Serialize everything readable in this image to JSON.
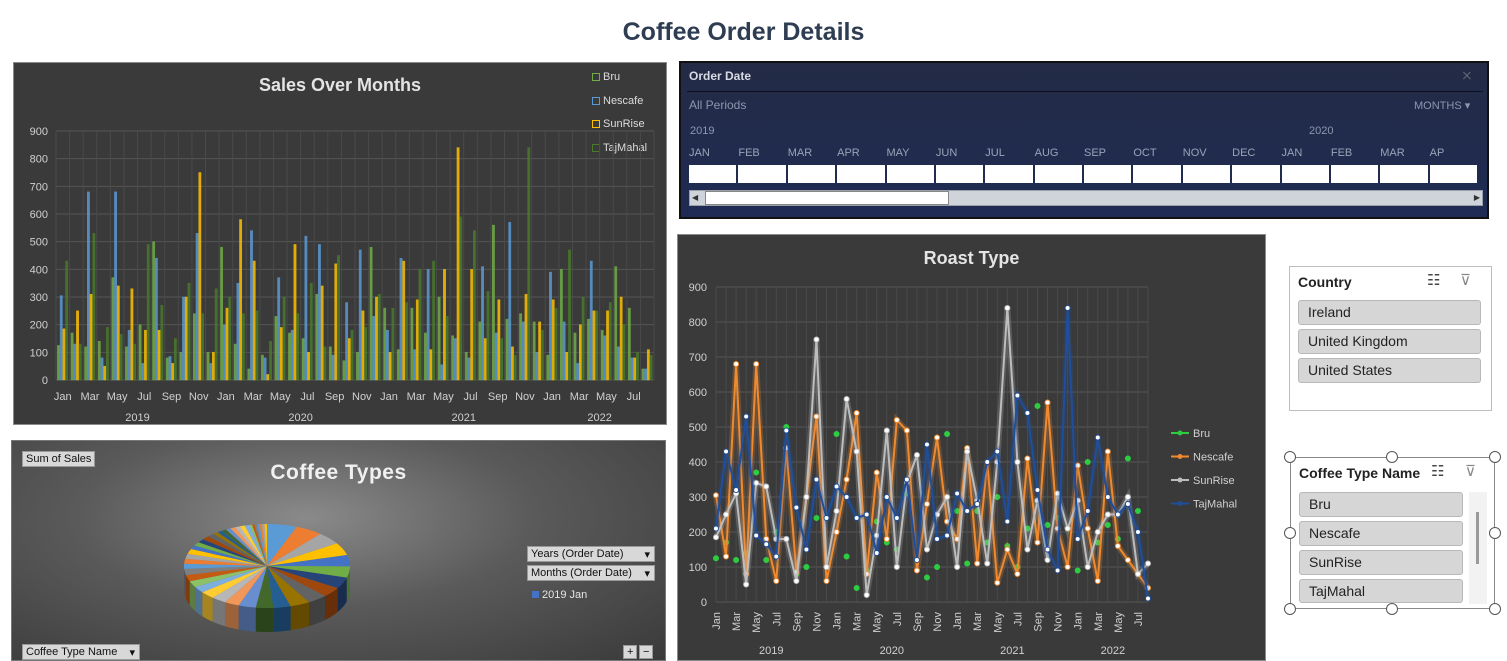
{
  "page": {
    "title": "Coffee Order Details"
  },
  "sales_chart": {
    "title": "Sales Over Months",
    "legend": [
      {
        "name": "Bru",
        "color": "#70ad47"
      },
      {
        "name": "Nescafe",
        "color": "#5b9bd5"
      },
      {
        "name": "SunRise",
        "color": "#ffc000"
      },
      {
        "name": "TajMahal",
        "color": "#4a7a2c"
      }
    ],
    "y_ticks": [
      "900",
      "800",
      "700",
      "600",
      "500",
      "400",
      "300",
      "200",
      "100",
      "0"
    ],
    "x_ticks": [
      "Jan",
      "Mar",
      "May",
      "Jul",
      "Sep",
      "Nov",
      "Jan",
      "Mar",
      "May",
      "Jul",
      "Sep",
      "Nov",
      "Jan",
      "Mar",
      "May",
      "Jul",
      "Sep",
      "Nov",
      "Jan",
      "Mar",
      "May",
      "Jul"
    ],
    "year_labels": [
      "2019",
      "2020",
      "2021",
      "2022"
    ]
  },
  "timeline": {
    "header": "Order Date",
    "periods": "All Periods",
    "unit": "MONTHS",
    "year_a": "2019",
    "year_b": "2020",
    "months": [
      "JAN",
      "FEB",
      "MAR",
      "APR",
      "MAY",
      "JUN",
      "JUL",
      "AUG",
      "SEP",
      "OCT",
      "NOV",
      "DEC",
      "JAN",
      "FEB",
      "MAR",
      "AP"
    ]
  },
  "pie_chart": {
    "title": "Coffee Types",
    "field_button": "Sum of Sales",
    "filter_years": "Years (Order Date)",
    "filter_months": "Months (Order Date)",
    "legend_entry": "2019 Jan",
    "axis_button": "Coffee Type Name"
  },
  "roast_chart": {
    "title": "Roast Type",
    "legend": [
      {
        "name": "Bru",
        "color": "#2ecc40"
      },
      {
        "name": "Nescafe",
        "color": "#f08a30"
      },
      {
        "name": "SunRise",
        "color": "#bdbdbd"
      },
      {
        "name": "TajMahal",
        "color": "#1f4e9a"
      }
    ],
    "y_ticks": [
      "900",
      "800",
      "700",
      "600",
      "500",
      "400",
      "300",
      "200",
      "100",
      "0"
    ],
    "x_ticks": [
      "Jan",
      "Mar",
      "May",
      "Jul",
      "Sep",
      "Nov",
      "Jan",
      "Mar",
      "May",
      "Jul",
      "Sep",
      "Nov",
      "Jan",
      "Mar",
      "May",
      "Jul",
      "Sep",
      "Nov",
      "Jan",
      "Mar",
      "May",
      "Jul"
    ],
    "year_labels": [
      "2019",
      "2020",
      "2021",
      "2022"
    ]
  },
  "country_slicer": {
    "title": "Country",
    "items": [
      "Ireland",
      "United Kingdom",
      "United States"
    ]
  },
  "coffee_slicer": {
    "title": "Coffee Type Name",
    "items": [
      "Bru",
      "Nescafe",
      "SunRise",
      "TajMahal"
    ]
  },
  "chart_data": [
    {
      "type": "bar",
      "title": "Sales Over Months",
      "ylim": [
        0,
        900
      ],
      "grid": true,
      "legend_position": "top-right",
      "x": [
        "2019-01",
        "2019-02",
        "2019-03",
        "2019-04",
        "2019-05",
        "2019-06",
        "2019-07",
        "2019-08",
        "2019-09",
        "2019-10",
        "2019-11",
        "2019-12",
        "2020-01",
        "2020-02",
        "2020-03",
        "2020-04",
        "2020-05",
        "2020-06",
        "2020-07",
        "2020-08",
        "2020-09",
        "2020-10",
        "2020-11",
        "2020-12",
        "2021-01",
        "2021-02",
        "2021-03",
        "2021-04",
        "2021-05",
        "2021-06",
        "2021-07",
        "2021-08",
        "2021-09",
        "2021-10",
        "2021-11",
        "2021-12",
        "2022-01",
        "2022-02",
        "2022-03",
        "2022-04",
        "2022-05",
        "2022-06",
        "2022-07",
        "2022-08"
      ],
      "series": [
        {
          "name": "Bru",
          "values": [
            125,
            170,
            120,
            140,
            370,
            120,
            200,
            500,
            80,
            100,
            240,
            100,
            480,
            130,
            40,
            90,
            230,
            170,
            150,
            310,
            120,
            70,
            100,
            480,
            260,
            110,
            260,
            170,
            300,
            160,
            100,
            210,
            560,
            220,
            240,
            210,
            90,
            400,
            170,
            220,
            180,
            410,
            260,
            40
          ]
        },
        {
          "name": "Nescafe",
          "values": [
            305,
            130,
            680,
            80,
            680,
            180,
            60,
            440,
            85,
            300,
            530,
            60,
            200,
            350,
            540,
            80,
            370,
            180,
            520,
            490,
            90,
            280,
            470,
            230,
            180,
            440,
            110,
            400,
            55,
            150,
            80,
            410,
            170,
            570,
            210,
            100,
            390,
            210,
            60,
            430,
            160,
            120,
            80,
            40
          ]
        },
        {
          "name": "SunRise",
          "values": [
            185,
            250,
            310,
            50,
            340,
            330,
            180,
            180,
            60,
            300,
            750,
            100,
            260,
            580,
            430,
            20,
            190,
            490,
            100,
            340,
            420,
            150,
            250,
            300,
            100,
            430,
            290,
            110,
            400,
            840,
            400,
            150,
            290,
            120,
            310,
            210,
            290,
            100,
            200,
            250,
            250,
            300,
            80,
            110
          ]
        },
        {
          "name": "TajMahal",
          "values": [
            430,
            130,
            530,
            190,
            165,
            130,
            490,
            270,
            150,
            350,
            240,
            330,
            300,
            240,
            250,
            140,
            300,
            240,
            350,
            120,
            450,
            180,
            190,
            310,
            260,
            280,
            400,
            430,
            230,
            590,
            540,
            320,
            150,
            90,
            840,
            180,
            260,
            470,
            300,
            250,
            280,
            200,
            100,
            90
          ]
        }
      ]
    },
    {
      "type": "pie",
      "title": "Coffee Types",
      "legend": [
        "2019 Jan"
      ],
      "slices": [
        12,
        11,
        10,
        10,
        9,
        9,
        9,
        8,
        8,
        8,
        7,
        7,
        7,
        6,
        6,
        6,
        5,
        5,
        5,
        5,
        4,
        4,
        4,
        4,
        3,
        3,
        3,
        3,
        3,
        2,
        2,
        2,
        2,
        2,
        2,
        2,
        2,
        1,
        1,
        1,
        1,
        1,
        1,
        1
      ]
    },
    {
      "type": "line",
      "title": "Roast Type",
      "ylim": [
        0,
        900
      ],
      "grid": true,
      "legend_position": "right",
      "x": [
        "2019-01",
        "2019-02",
        "2019-03",
        "2019-04",
        "2019-05",
        "2019-06",
        "2019-07",
        "2019-08",
        "2019-09",
        "2019-10",
        "2019-11",
        "2019-12",
        "2020-01",
        "2020-02",
        "2020-03",
        "2020-04",
        "2020-05",
        "2020-06",
        "2020-07",
        "2020-08",
        "2020-09",
        "2020-10",
        "2020-11",
        "2020-12",
        "2021-01",
        "2021-02",
        "2021-03",
        "2021-04",
        "2021-05",
        "2021-06",
        "2021-07",
        "2021-08",
        "2021-09",
        "2021-10",
        "2021-11",
        "2021-12",
        "2022-01",
        "2022-02",
        "2022-03",
        "2022-04",
        "2022-05",
        "2022-06",
        "2022-07",
        "2022-08"
      ],
      "series": [
        {
          "name": "Bru",
          "values": [
            125,
            170,
            120,
            140,
            370,
            120,
            200,
            500,
            80,
            100,
            240,
            100,
            480,
            130,
            40,
            90,
            230,
            170,
            150,
            310,
            120,
            70,
            100,
            480,
            260,
            110,
            260,
            170,
            300,
            160,
            100,
            210,
            560,
            220,
            240,
            210,
            90,
            400,
            170,
            220,
            180,
            410,
            260,
            40
          ]
        },
        {
          "name": "Nescafe",
          "values": [
            305,
            130,
            680,
            80,
            680,
            180,
            60,
            440,
            85,
            300,
            530,
            60,
            200,
            350,
            540,
            80,
            370,
            180,
            520,
            490,
            90,
            280,
            470,
            230,
            180,
            440,
            110,
            400,
            55,
            150,
            80,
            410,
            170,
            570,
            210,
            100,
            390,
            210,
            60,
            430,
            160,
            120,
            80,
            40
          ]
        },
        {
          "name": "SunRise",
          "values": [
            185,
            250,
            310,
            50,
            340,
            330,
            180,
            180,
            60,
            300,
            750,
            100,
            260,
            580,
            430,
            20,
            190,
            490,
            100,
            340,
            420,
            150,
            250,
            300,
            100,
            430,
            290,
            110,
            400,
            840,
            400,
            150,
            290,
            120,
            310,
            210,
            290,
            100,
            200,
            250,
            250,
            300,
            80,
            110
          ]
        },
        {
          "name": "TajMahal",
          "values": [
            210,
            430,
            320,
            530,
            190,
            165,
            130,
            490,
            270,
            150,
            350,
            240,
            330,
            300,
            240,
            250,
            140,
            300,
            240,
            350,
            120,
            450,
            180,
            190,
            310,
            260,
            280,
            400,
            430,
            230,
            590,
            540,
            320,
            150,
            90,
            840,
            180,
            260,
            470,
            300,
            250,
            280,
            200,
            10
          ]
        }
      ]
    }
  ]
}
